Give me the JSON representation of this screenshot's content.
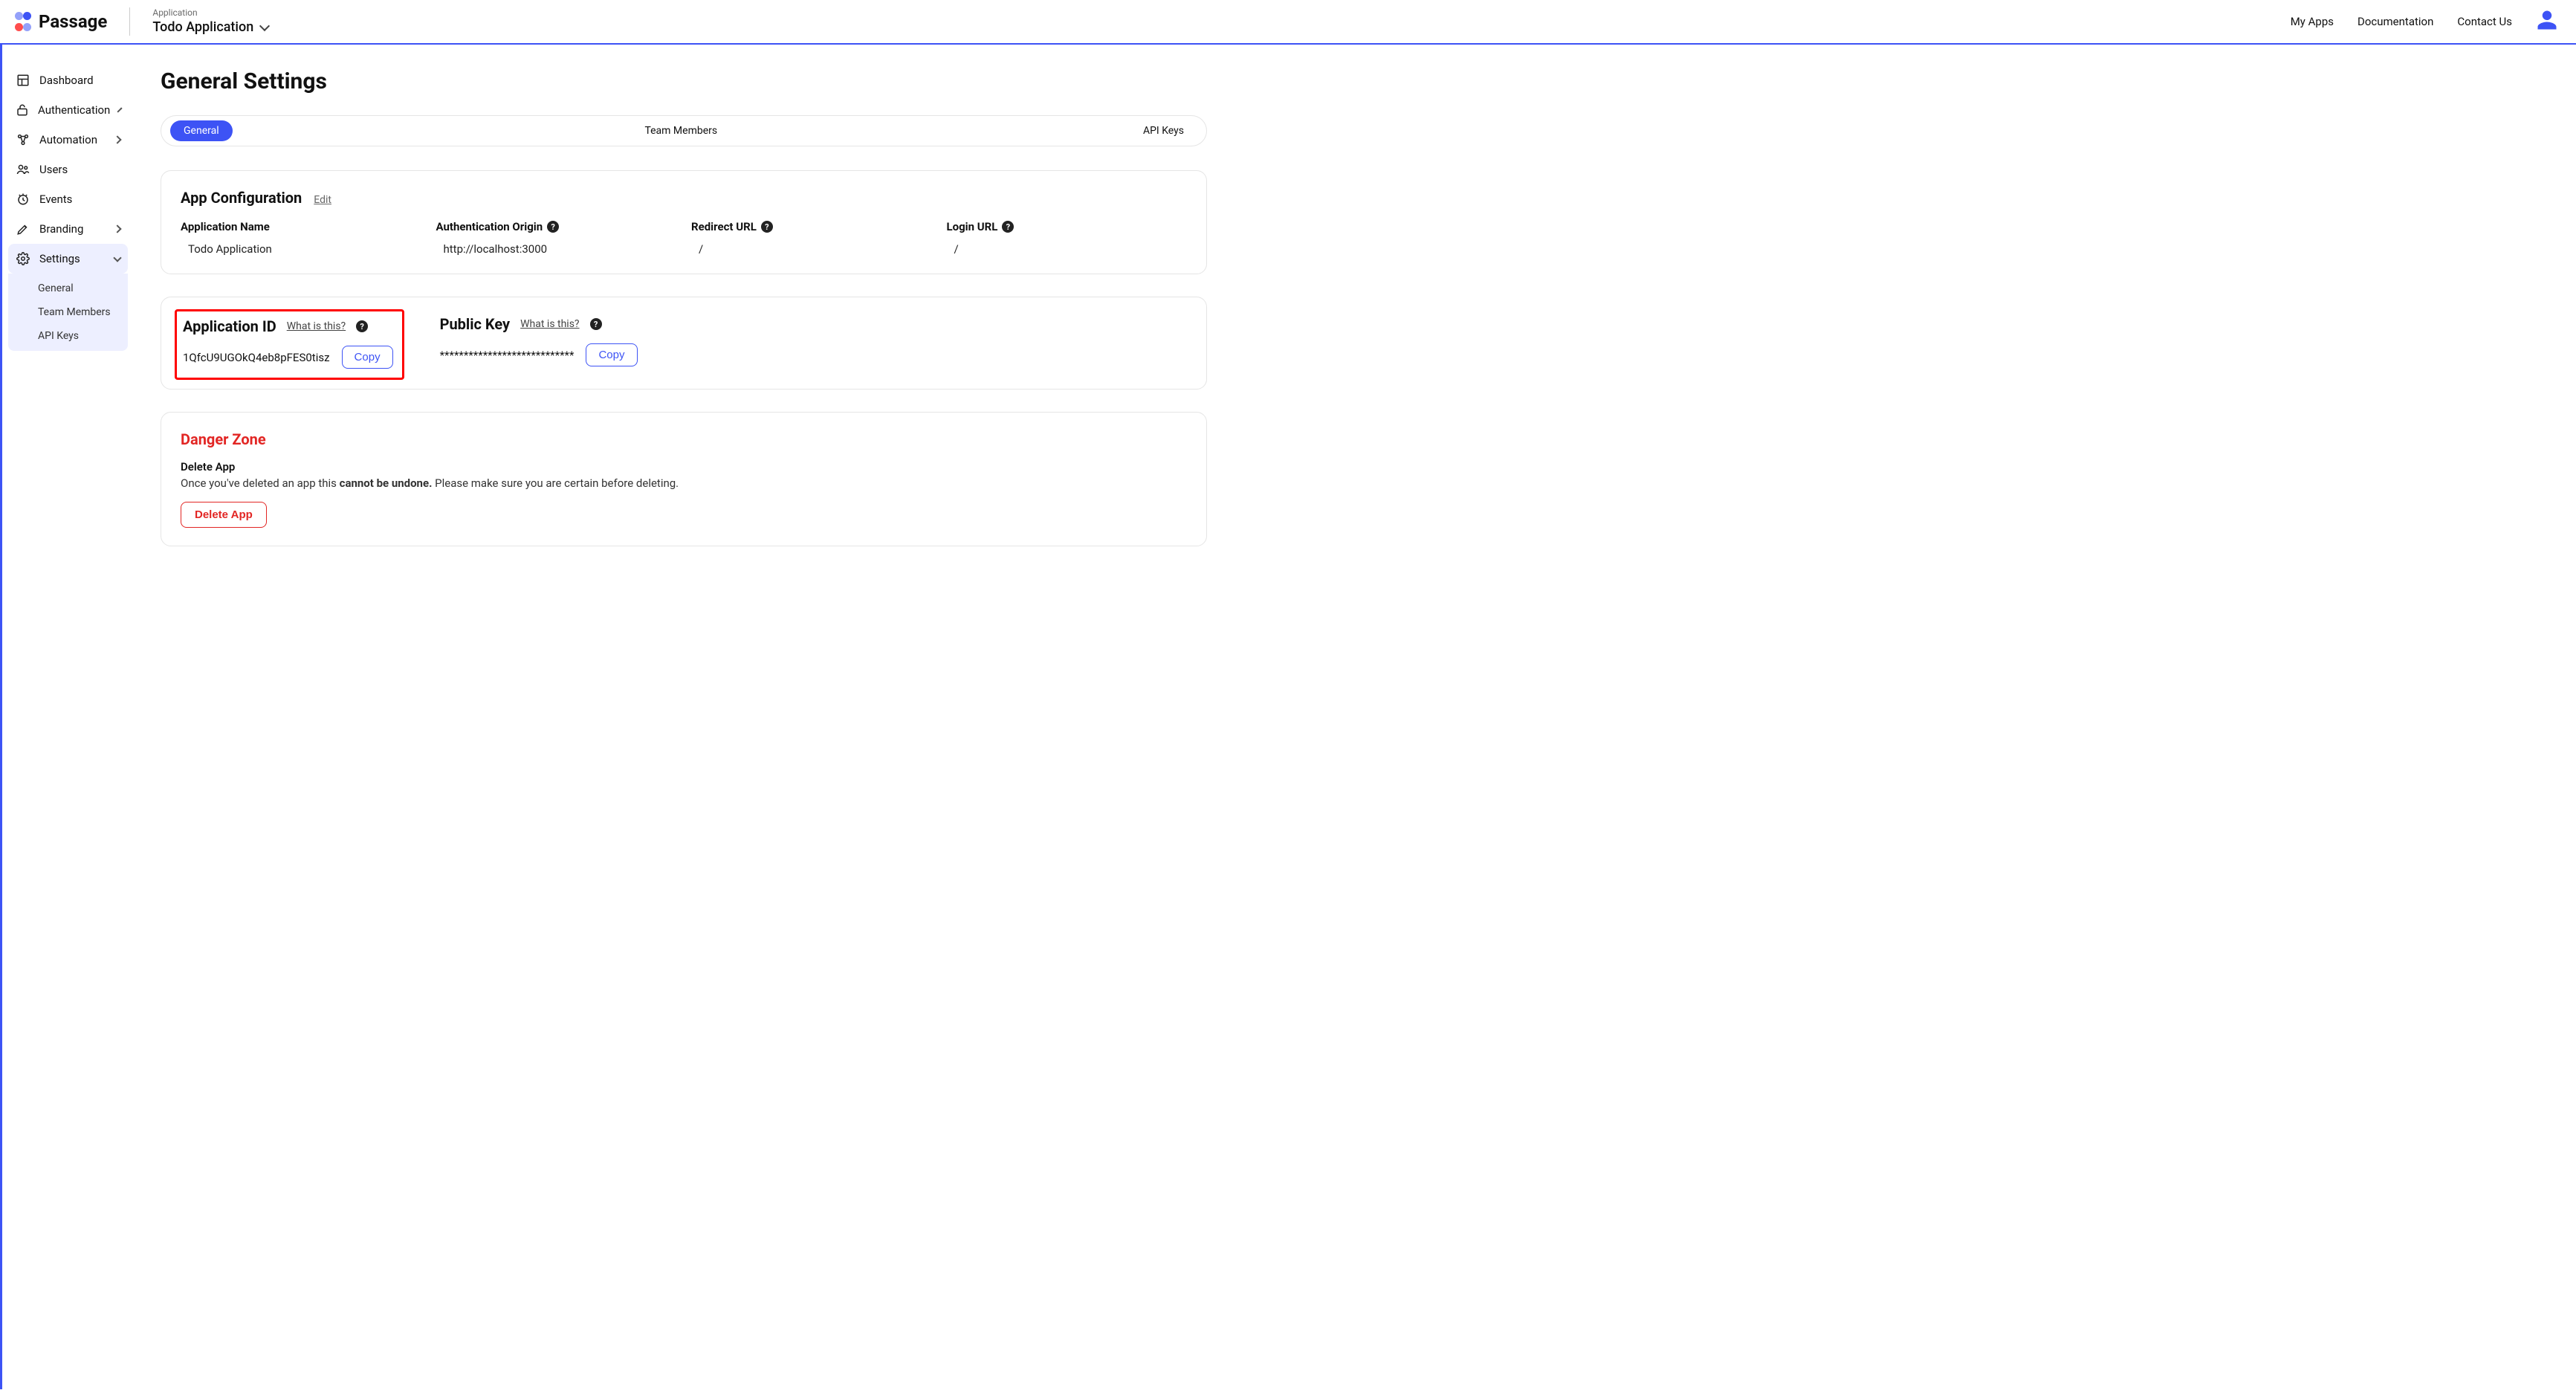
{
  "header": {
    "brand": "Passage",
    "app_label": "Application",
    "app_name": "Todo Application",
    "nav": {
      "my_apps": "My Apps",
      "docs": "Documentation",
      "contact": "Contact Us"
    }
  },
  "sidebar": {
    "dashboard": "Dashboard",
    "authentication": "Authentication",
    "automation": "Automation",
    "users": "Users",
    "events": "Events",
    "branding": "Branding",
    "settings": "Settings",
    "sub": {
      "general": "General",
      "team": "Team Members",
      "api_keys": "API Keys"
    }
  },
  "page": {
    "title": "General Settings",
    "tabs": {
      "general": "General",
      "team": "Team Members",
      "api_keys": "API Keys"
    }
  },
  "app_config": {
    "heading": "App Configuration",
    "edit": "Edit",
    "name_label": "Application Name",
    "name_value": "Todo Application",
    "origin_label": "Authentication Origin",
    "origin_value": "http://localhost:3000",
    "redirect_label": "Redirect URL",
    "redirect_value": "/",
    "login_label": "Login URL",
    "login_value": "/"
  },
  "app_id": {
    "heading": "Application ID",
    "what": "What is this?",
    "value": "1QfcU9UGOkQ4eb8pFES0tisz",
    "copy": "Copy"
  },
  "public_key": {
    "heading": "Public Key",
    "what": "What is this?",
    "value": "****************************",
    "copy": "Copy"
  },
  "danger": {
    "heading": "Danger Zone",
    "sub": "Delete App",
    "msg_pre": "Once you've deleted an app this ",
    "msg_bold": "cannot be undone.",
    "msg_post": " Please make sure you are certain before deleting.",
    "button": "Delete App"
  }
}
